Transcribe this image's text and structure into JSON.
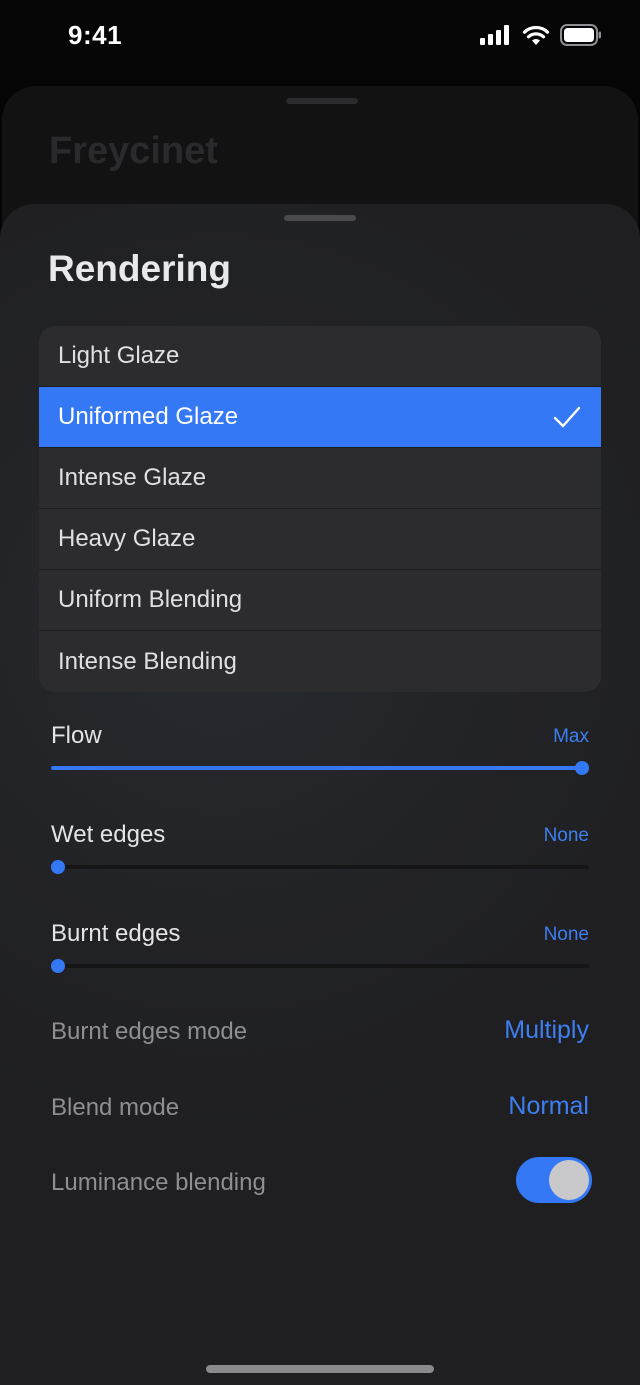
{
  "status_bar": {
    "time": "9:41"
  },
  "back_sheet": {
    "title": "Freycinet"
  },
  "sheet": {
    "title": "Rendering"
  },
  "options": [
    {
      "label": "Light Glaze",
      "selected": false
    },
    {
      "label": "Uniformed Glaze",
      "selected": true
    },
    {
      "label": "Intense Glaze",
      "selected": false
    },
    {
      "label": "Heavy Glaze",
      "selected": false
    },
    {
      "label": "Uniform Blending",
      "selected": false
    },
    {
      "label": "Intense Blending",
      "selected": false
    }
  ],
  "sliders": {
    "flow": {
      "label": "Flow",
      "value_label": "Max",
      "level": 1.0
    },
    "wet_edges": {
      "label": "Wet edges",
      "value_label": "None",
      "level": 0.0
    },
    "burnt_edges": {
      "label": "Burnt edges",
      "value_label": "None",
      "level": 0.0
    }
  },
  "settings": {
    "burnt_edges_mode": {
      "label": "Burnt edges mode",
      "value": "Multiply"
    },
    "blend_mode": {
      "label": "Blend mode",
      "value": "Normal"
    },
    "luminance_blending": {
      "label": "Luminance blending",
      "on": true
    }
  },
  "colors": {
    "accent": "#3478f6",
    "background": "#1f1f21",
    "list_background": "#2c2c2f"
  },
  "icons": {
    "selected": "checkmark-icon",
    "signal": "cellular-signal-icon",
    "wifi": "wifi-icon",
    "battery": "battery-icon"
  }
}
